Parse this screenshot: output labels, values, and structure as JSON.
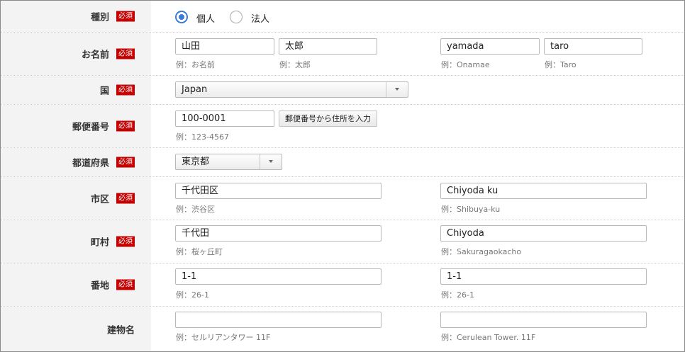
{
  "required_badge": "必須",
  "colors": {
    "required": "#c40000",
    "radio_accent": "#3a7bd5",
    "label_bg": "#f3f3f3"
  },
  "type": {
    "label": "種別",
    "options": [
      "個人",
      "法人"
    ],
    "selected": "個人"
  },
  "name": {
    "label": "お名前",
    "last_kanji": "山田",
    "first_kanji": "太郎",
    "last_roman": "yamada",
    "first_roman": "taro",
    "hint_last_kanji": "例：お名前",
    "hint_first_kanji": "例：太郎",
    "hint_last_roman": "例：Onamae",
    "hint_first_roman": "例：Taro"
  },
  "country": {
    "label": "国",
    "value": "Japan"
  },
  "postal": {
    "label": "郵便番号",
    "value": "100-0001",
    "button": "郵便番号から住所を入力",
    "hint": "例：123-4567"
  },
  "prefecture": {
    "label": "都道府県",
    "value": "東京都"
  },
  "city": {
    "label": "市区",
    "value_ja": "千代田区",
    "value_en": "Chiyoda ku",
    "hint_ja": "例：渋谷区",
    "hint_en": "例：Shibuya-ku"
  },
  "town": {
    "label": "町村",
    "value_ja": "千代田",
    "value_en": "Chiyoda",
    "hint_ja": "例：桜ヶ丘町",
    "hint_en": "例：Sakuragaokacho"
  },
  "banchi": {
    "label": "番地",
    "value_ja": "1-1",
    "value_en": "1-1",
    "hint_ja": "例：26-1",
    "hint_en": "例：26-1"
  },
  "building": {
    "label": "建物名",
    "value_ja": "",
    "value_en": "",
    "hint_ja": "例：セルリアンタワー 11F",
    "hint_en": "例：Cerulean Tower. 11F"
  }
}
